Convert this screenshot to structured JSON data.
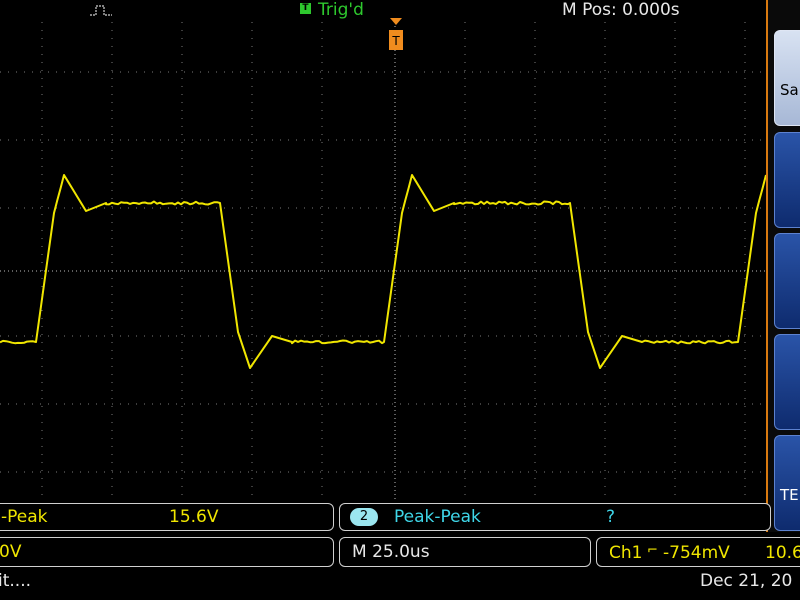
{
  "top": {
    "trigger_status": "Trig'd",
    "trigger_badge": "T",
    "horizontal_position": "M Pos: 0.000s"
  },
  "softmenu": {
    "button1_label": "Sa",
    "button5_label": "TE"
  },
  "measurements": {
    "m1_name": "-Peak",
    "m1_value": "15.6V",
    "m2_channel": "2",
    "m2_name": "Peak-Peak",
    "m2_value": "?"
  },
  "status": {
    "ch1_scale": "0V",
    "timebase": "M 25.0us",
    "trigger_source": "Ch1",
    "trigger_slope": "⌐",
    "trigger_level": "-754mV",
    "trigger_freq": "10.6",
    "message": "it....",
    "date": "Dec 21, 20"
  },
  "colors": {
    "ch1": "#f0e600",
    "ch2": "#3fd6e8",
    "trig": "#2ec82e",
    "menu_border": "#d97a10",
    "trigger_marker": "#f08c1e"
  }
}
